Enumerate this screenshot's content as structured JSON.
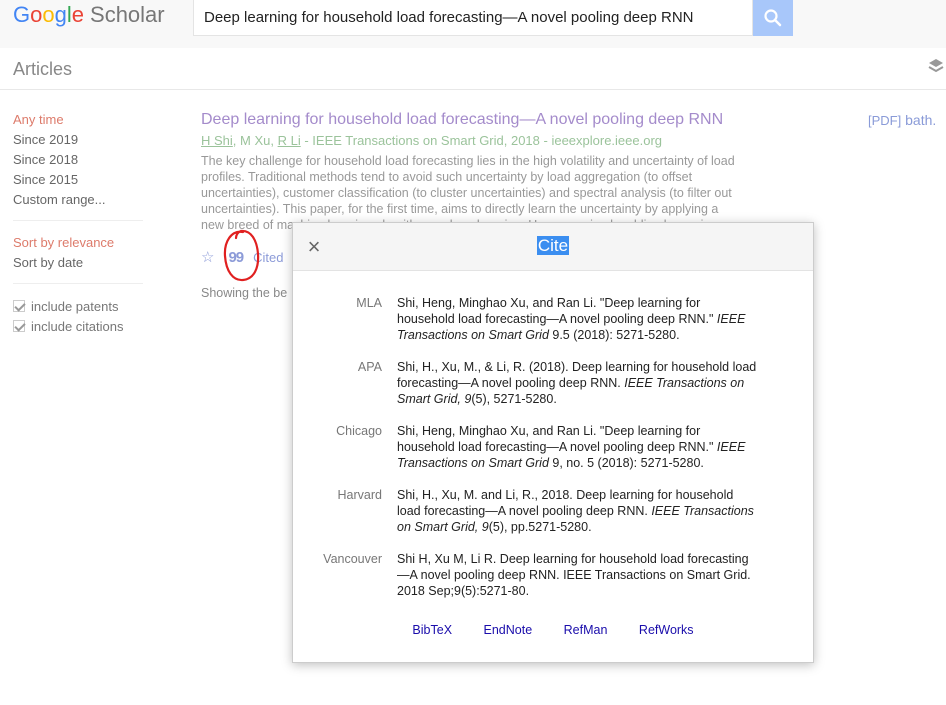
{
  "header": {
    "logo_google": "Google",
    "logo_scholar": "Scholar",
    "search_value": "Deep learning for household load forecasting—A novel pooling deep RNN"
  },
  "subheader": {
    "title": "Articles"
  },
  "sidebar": {
    "time_items": [
      "Any time",
      "Since 2019",
      "Since 2018",
      "Since 2015",
      "Custom range..."
    ],
    "sort_items": [
      "Sort by relevance",
      "Sort by date"
    ],
    "checks": [
      "include patents",
      "include citations"
    ]
  },
  "result": {
    "title": "Deep learning for household load forecasting—A novel pooling deep RNN",
    "author1": "H Shi",
    "author2": "M Xu",
    "author3": "R Li",
    "source": " - IEEE Transactions on Smart Grid, 2018 - ieeexplore.ieee.org",
    "snippet": "The key challenge for household load forecasting lies in the high volatility and uncertainty of load profiles. Traditional methods tend to avoid such uncertainty by load aggregation (to offset uncertainties), customer classification (to cluster uncertainties) and spectral analysis (to filter out uncertainties). This paper, for the first time, aims to directly learn the uncertainty by applying a new breed of machine learning algorithms—deep learning. However, simply adding layers in",
    "cited_label": "Cited",
    "pdf_tag": "[PDF]",
    "pdf_domain": "bath."
  },
  "showing_text": "Showing the be",
  "modal": {
    "title": "Cite",
    "close_icon": "×",
    "citations": [
      {
        "style": "MLA",
        "before": "Shi, Heng, Minghao Xu, and Ran Li. \"Deep learning for household load forecasting—A novel pooling deep RNN.\" ",
        "italic": "IEEE Transactions on Smart Grid",
        "after": " 9.5 (2018): 5271-5280."
      },
      {
        "style": "APA",
        "before": "Shi, H., Xu, M., & Li, R. (2018). Deep learning for household load forecasting—A novel pooling deep RNN. ",
        "italic": "IEEE Transactions on Smart Grid, 9",
        "after": "(5), 5271-5280."
      },
      {
        "style": "Chicago",
        "before": "Shi, Heng, Minghao Xu, and Ran Li. \"Deep learning for household load forecasting—A novel pooling deep RNN.\" ",
        "italic": "IEEE Transactions on Smart Grid",
        "after": " 9, no. 5 (2018): 5271-5280."
      },
      {
        "style": "Harvard",
        "before": "Shi, H., Xu, M. and Li, R., 2018. Deep learning for household load forecasting—A novel pooling deep RNN. ",
        "italic": "IEEE Transactions on Smart Grid, 9",
        "after": "(5), pp.5271-5280."
      },
      {
        "style": "Vancouver",
        "before": "Shi H, Xu M, Li R. Deep learning for household load forecasting—A novel pooling deep RNN. IEEE Transactions on Smart Grid. 2018 Sep;9(5):5271-80.",
        "italic": "",
        "after": ""
      }
    ],
    "export_links": [
      "BibTeX",
      "EndNote",
      "RefMan",
      "RefWorks"
    ]
  },
  "colors": {
    "accent": "#4285f4",
    "title_link": "#a48bcb",
    "highlight": "#3b8ef0",
    "annotation": "#e02020"
  },
  "icons": {
    "search": "search-icon",
    "layers": "layers-icon",
    "star": "star-icon",
    "cite": "quote-icon",
    "close": "close-icon"
  }
}
